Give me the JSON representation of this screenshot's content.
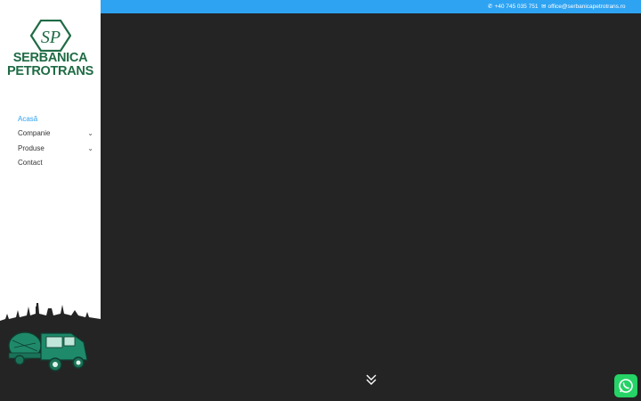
{
  "brand": {
    "initials": "SP",
    "line1": "SERBANICA",
    "line2": "PETROTRANS",
    "color": "#1f6b45"
  },
  "nav": {
    "items": [
      {
        "label": "Acasă",
        "active": true,
        "has_submenu": false
      },
      {
        "label": "Companie",
        "active": false,
        "has_submenu": true
      },
      {
        "label": "Produse",
        "active": false,
        "has_submenu": true
      },
      {
        "label": "Contact",
        "active": false,
        "has_submenu": false
      }
    ]
  },
  "topbar": {
    "phone": "+40 745 035 751",
    "email": "office@serbanicapetrotrans.ro",
    "phone_icon": "phone-icon",
    "email_icon": "envelope-icon",
    "background": "#2ea3f2"
  },
  "hero": {
    "background": "#242424",
    "scroll_icon": "double-chevron-down-icon"
  },
  "whatsapp": {
    "icon": "whatsapp-icon",
    "color": "#25d366"
  }
}
